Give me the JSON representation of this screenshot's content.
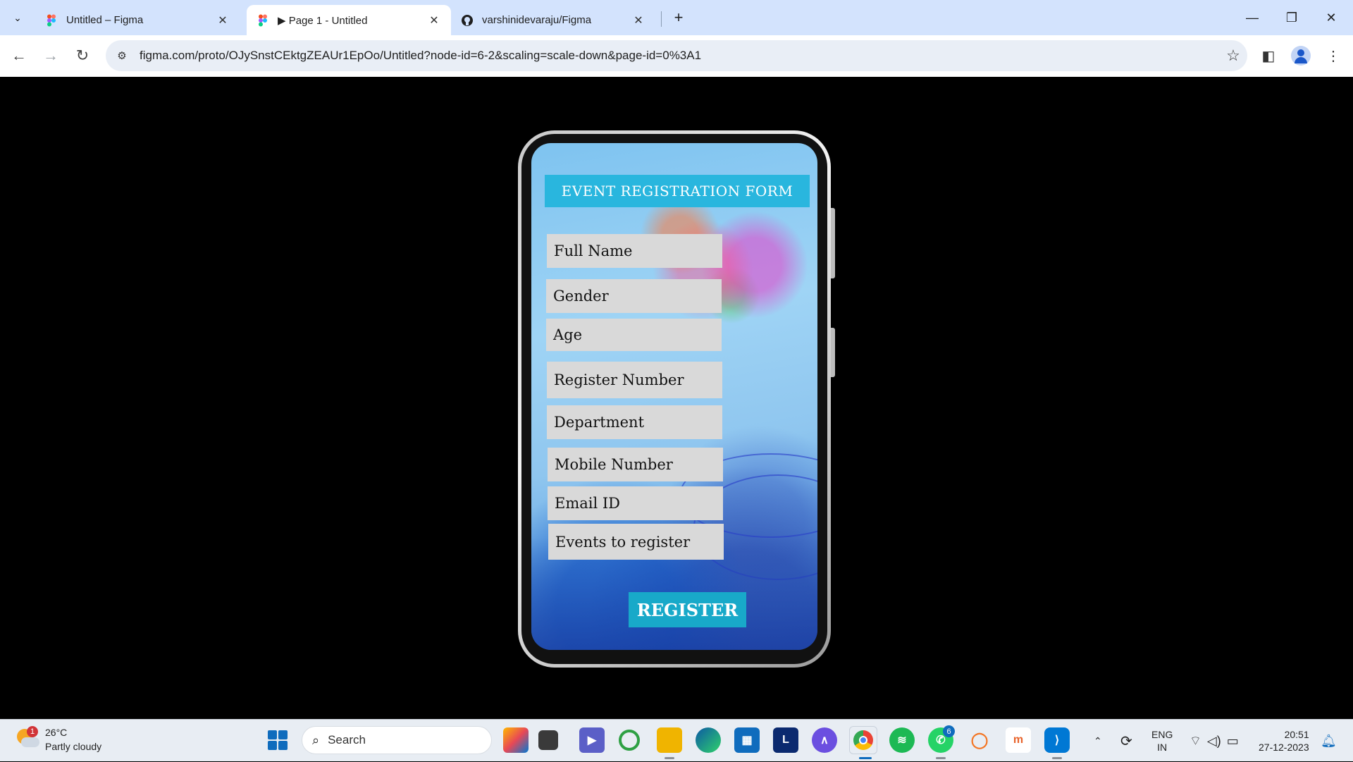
{
  "browser": {
    "tabs": [
      {
        "title": "Untitled – Figma",
        "icon": "figma-icon",
        "active": false
      },
      {
        "title": "▶ Page 1 - Untitled",
        "icon": "figma-icon",
        "active": true
      },
      {
        "title": "varshinidevaraju/Figma",
        "icon": "github-icon",
        "active": false
      }
    ],
    "url": "figma.com/proto/OJySnstCEktgZEAUr1EpOo/Untitled?node-id=6-2&scaling=scale-down&page-id=0%3A1"
  },
  "form": {
    "title": "EVENT REGISTRATION FORM",
    "fields": [
      "Full Name",
      "Gender",
      "Age",
      "Register Number",
      "Department",
      "Mobile Number",
      "Email ID",
      "Events to register"
    ],
    "submit_label": "REGISTER"
  },
  "taskbar": {
    "weather_temp": "26°C",
    "weather_desc": "Partly cloudy",
    "weather_badge": "1",
    "search_placeholder": "Search",
    "whatsapp_badge": "6",
    "lang_primary": "ENG",
    "lang_secondary": "IN",
    "time": "20:51",
    "date": "27-12-2023"
  },
  "colors": {
    "title_bg": "#29b6de",
    "button_bg": "#18a9c9",
    "field_bg": "#d9d9d9",
    "tabbar_bg": "#d3e3fd"
  }
}
